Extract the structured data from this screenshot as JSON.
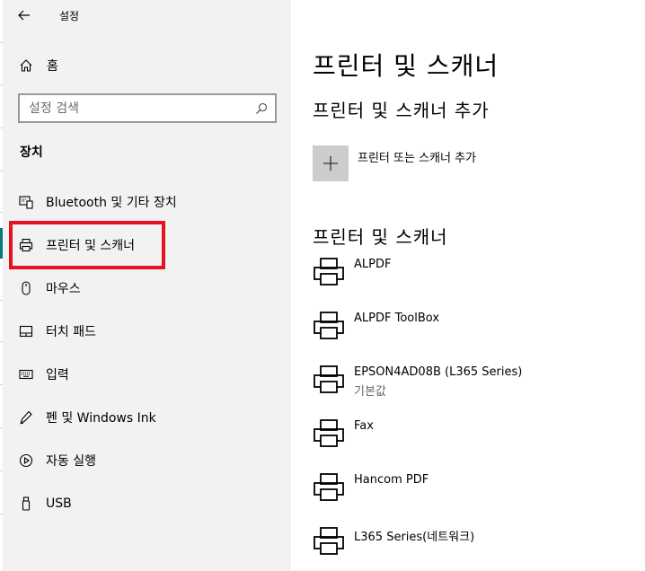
{
  "window": {
    "title": "설정"
  },
  "sidebar": {
    "home_label": "홈",
    "search_placeholder": "설정 검색",
    "section_title": "장치",
    "items": [
      {
        "label": "Bluetooth 및 기타 장치",
        "icon": "bluetooth-devices-icon"
      },
      {
        "label": "프린터 및 스캐너",
        "icon": "printer-icon"
      },
      {
        "label": "마우스",
        "icon": "mouse-icon"
      },
      {
        "label": "터치 패드",
        "icon": "touchpad-icon"
      },
      {
        "label": "입력",
        "icon": "keyboard-icon"
      },
      {
        "label": "펜 및 Windows Ink",
        "icon": "pen-icon"
      },
      {
        "label": "자동 실행",
        "icon": "autoplay-icon"
      },
      {
        "label": "USB",
        "icon": "usb-icon"
      }
    ],
    "selected_index": 1
  },
  "main": {
    "title": "프린터 및 스캐너",
    "add_section_title": "프린터 및 스캐너 추가",
    "add_button_label": "프린터 또는 스캐너 추가",
    "list_section_title": "프린터 및 스캐너",
    "printers": [
      {
        "name": "ALPDF"
      },
      {
        "name": "ALPDF ToolBox"
      },
      {
        "name": "EPSON4AD08B (L365 Series)",
        "status": "기본값"
      },
      {
        "name": "Fax"
      },
      {
        "name": "Hancom PDF"
      },
      {
        "name": "L365 Series(네트워크)"
      }
    ]
  },
  "colors": {
    "sidebar_bg": "#f2f2f2",
    "highlight": "#e81123",
    "accent": "#007a7a",
    "add_button_bg": "#cccccc"
  }
}
